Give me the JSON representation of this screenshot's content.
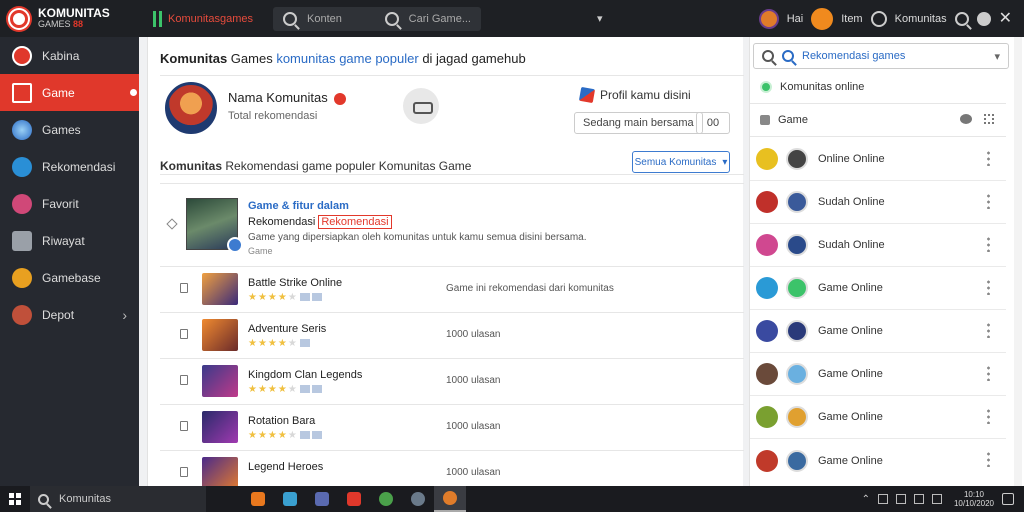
{
  "app": {
    "logo_title": "KOMUNITAS",
    "logo_sub_prefix": "GAMES ",
    "logo_sub_suffix": "88",
    "brand_label": "Komunitasgames",
    "search_left": "Konten",
    "search_right": "Cari Game..."
  },
  "topbar": {
    "user_label": "Hai",
    "coins_label": "Item",
    "community_label": "Komunitas"
  },
  "sidebar": {
    "items": [
      {
        "label": "Kabina"
      },
      {
        "label": "Game"
      },
      {
        "label": "Games"
      },
      {
        "label": "Rekomendasi"
      },
      {
        "label": "Favorit"
      },
      {
        "label": "Riwayat"
      },
      {
        "label": "Gamebase"
      },
      {
        "label": "Depot"
      }
    ]
  },
  "main": {
    "title_bold": "Komunitas",
    "title_rest": " ",
    "title_tag": "Games",
    "title_link": "komunitas game populer",
    "title_suffix": "di jagad gamehub",
    "profile": {
      "name": "Nama Komunitas",
      "sub": "Total rekomendasi",
      "link_label": "Profil kamu disini",
      "button_label": "Sedang main bersama",
      "button2_label": "00"
    },
    "section": {
      "title_bold": "Komunitas",
      "title_rest": " Rekomendasi game populer Komunitas Game",
      "dropdown_label": "Semua Komunitas"
    },
    "featured": {
      "title": "Game & fitur dalam",
      "sub_prefix": "Rekomendasi ",
      "sub_highlight": "Rekomendasi",
      "desc": "Game yang dipersiapkan oleh komunitas untuk kamu semua disini bersama.",
      "meta": "Game"
    },
    "games": [
      {
        "title": "Battle Strike Online",
        "meta": "Game ini rekomendasi dari komunitas"
      },
      {
        "title": "Adventure Seris",
        "meta": "1000 ulasan"
      },
      {
        "title": "Kingdom Clan Legends",
        "meta": "1000 ulasan"
      },
      {
        "title": "Rotation Bara",
        "meta": "1000 ulasan"
      },
      {
        "title": "Legend Heroes",
        "meta": "1000 ulasan"
      }
    ]
  },
  "right": {
    "search_placeholder": "Rekomendasi games",
    "status_label": "Komunitas online",
    "header_label": "Game",
    "friends": [
      {
        "status": "Online Online"
      },
      {
        "status": "Sudah Online"
      },
      {
        "status": "Sudah Online"
      },
      {
        "status": "Game Online"
      },
      {
        "status": "Game Online"
      },
      {
        "status": "Game Online"
      },
      {
        "status": "Game Online"
      },
      {
        "status": "Game Online"
      }
    ]
  },
  "taskbar": {
    "search_label": "Komunitas",
    "clock_time": "10:10",
    "clock_date": "10/10/2020"
  },
  "colors": {
    "accent_red": "#e0382b",
    "accent_blue": "#2a6bc5",
    "online_green": "#3cc36a",
    "sidebar_bg": "#262930"
  }
}
